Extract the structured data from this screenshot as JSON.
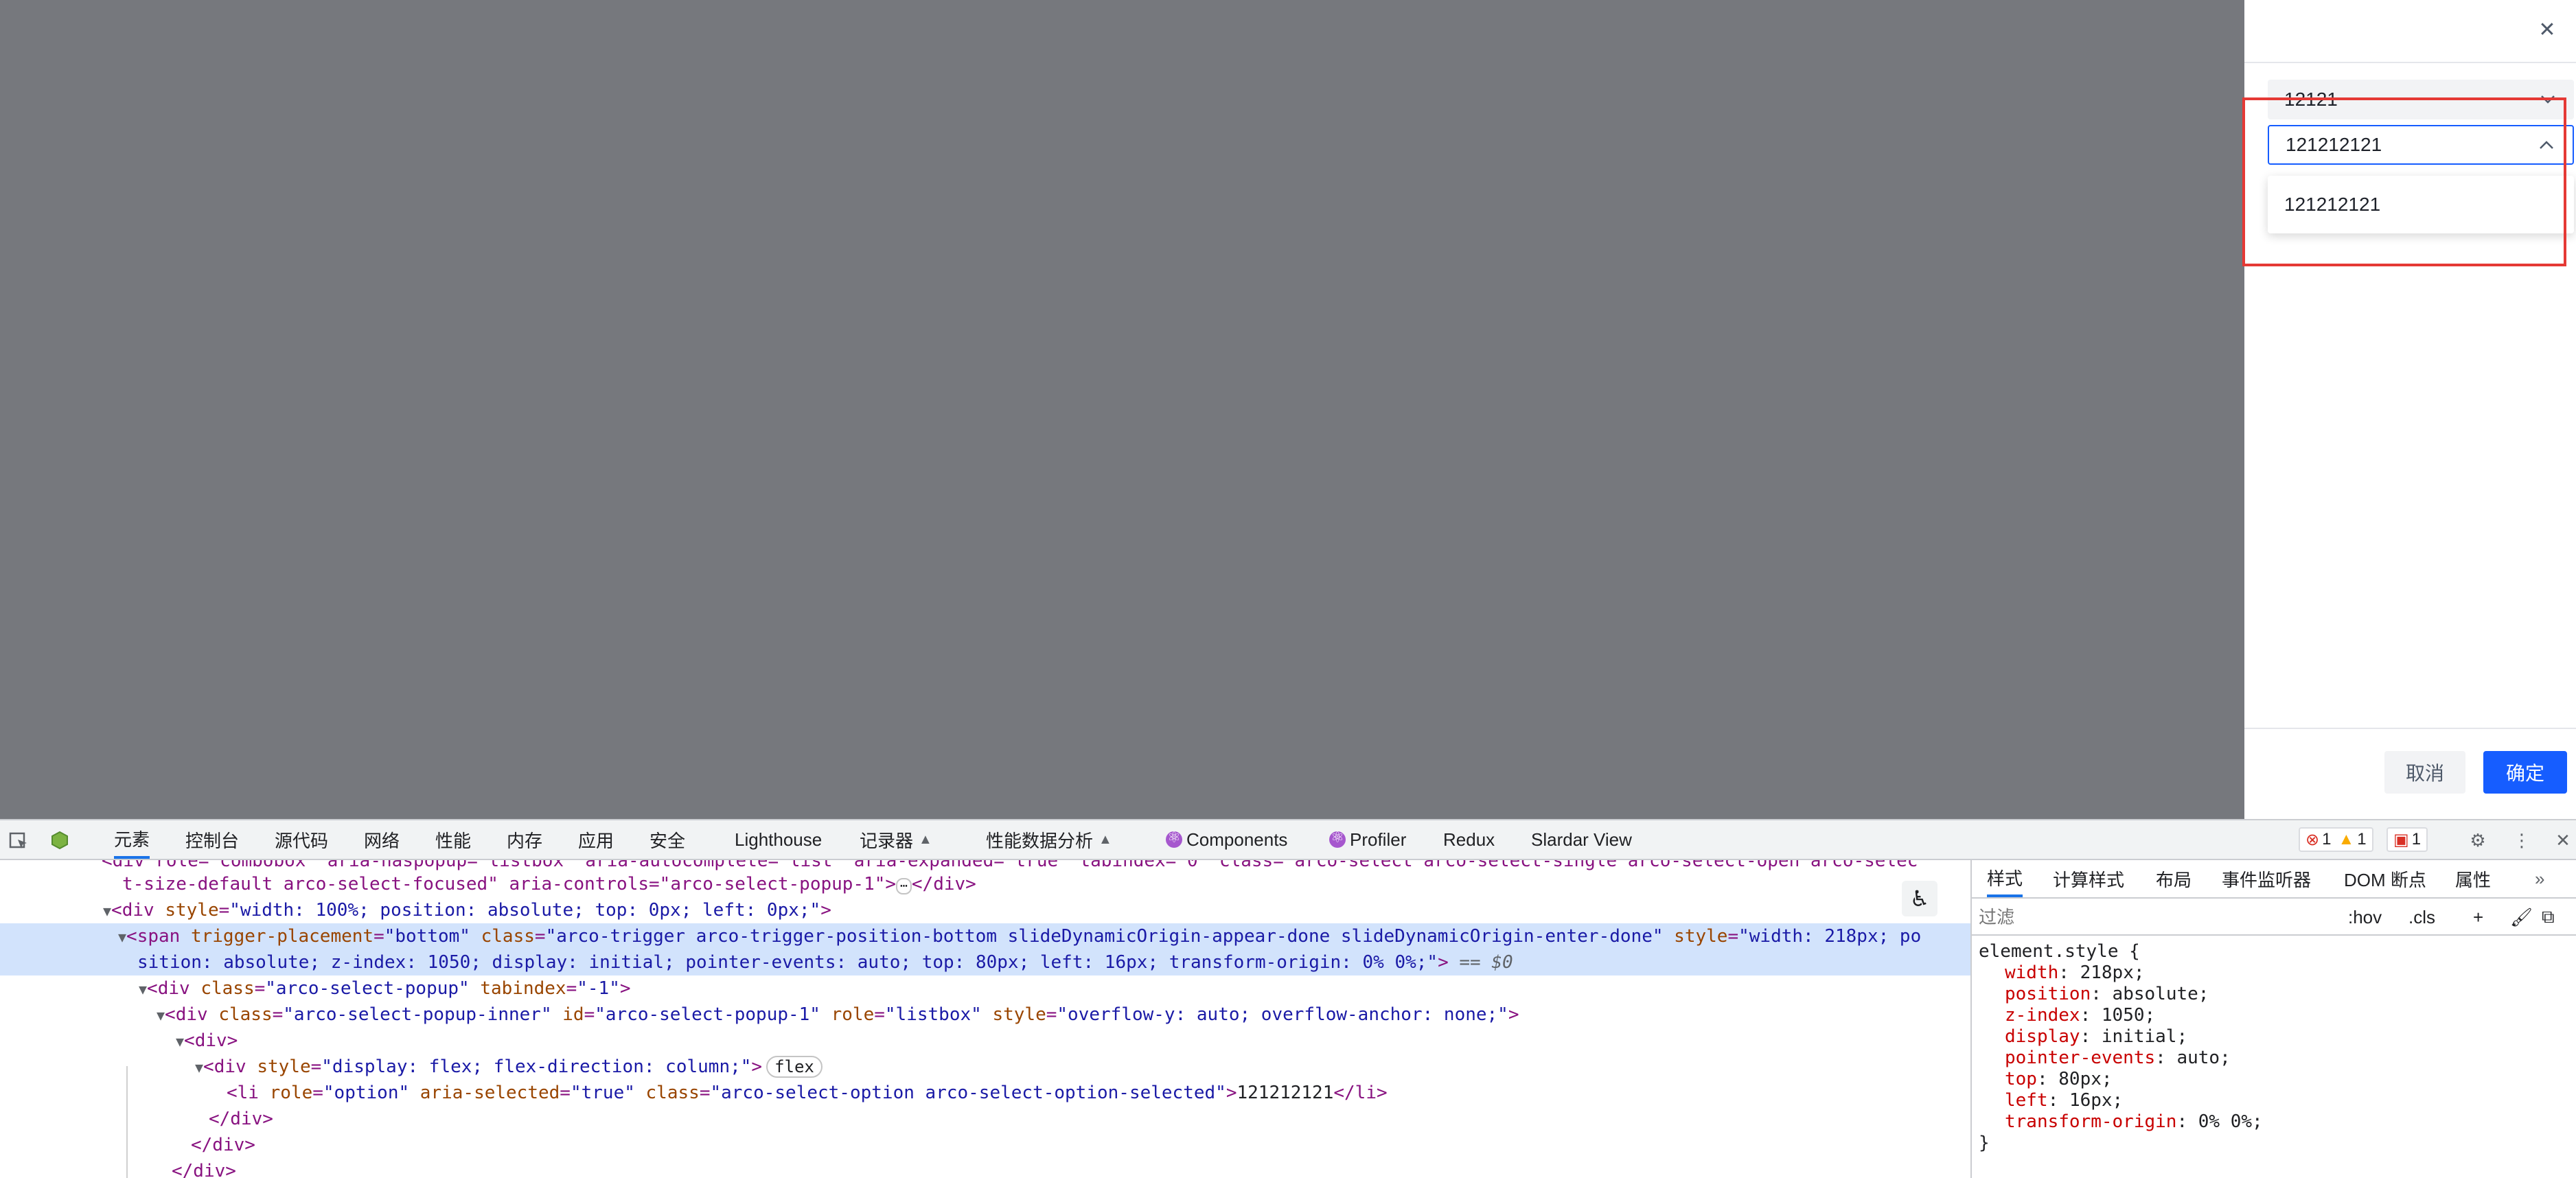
{
  "drawer": {
    "close_icon": "close-icon",
    "select1_value": "12121",
    "select2_value": "121212121",
    "popup_option": "121212121",
    "cancel_label": "取消",
    "ok_label": "确定",
    "accent_color": "#165dff",
    "highlight_color": "#e53935"
  },
  "devtools": {
    "tabs": [
      "元素",
      "控制台",
      "源代码",
      "网络",
      "性能",
      "内存",
      "应用",
      "安全",
      "Lighthouse",
      "记录器",
      "性能数据分析",
      "Components",
      "Profiler",
      "Redux",
      "Slardar View"
    ],
    "badges": {
      "errors": "1",
      "warnings": "1",
      "issues": "1"
    },
    "code": {
      "l0": "<div role=\"combobox\" aria-haspopup=\"listbox\" aria-autocomplete=\"list\" aria-expanded=\"true\" tabindex=\"0\" class=\"arco-select arco-select-single arco-select-open arco-selec",
      "l1": "t-size-default arco-select-focused\" aria-controls=\"arco-select-popup-1\">",
      "l1_ellipsis": "⋯",
      "l1_close": "</div>",
      "l2_tag": "<div ",
      "l2_attr": "style",
      "l2_val": "\"width: 100%; position: absolute; top: 0px; left: 0px;\"",
      "l3_tag": "<span ",
      "l3_a1": "trigger-placement",
      "l3_v1": "\"bottom\"",
      "l3_a2": "class",
      "l3_v2": "\"arco-trigger arco-trigger-position-bottom slideDynamicOrigin-appear-done slideDynamicOrigin-enter-done\"",
      "l3_a3": "style",
      "l3_v3a": "\"width: 218px; po",
      "l4_v3b": "sition: absolute; z-index: 1050; display: initial; pointer-events: auto; top: 80px; left: 16px; transform-origin: 0% 0%;\"",
      "l4_eq": " == $0",
      "l5_tag": "<div ",
      "l5_a1": "class",
      "l5_v1": "\"arco-select-popup\"",
      "l5_a2": "tabindex",
      "l5_v2": "\"-1\"",
      "l6_tag": "<div ",
      "l6_a1": "class",
      "l6_v1": "\"arco-select-popup-inner\"",
      "l6_a2": "id",
      "l6_v2": "\"arco-select-popup-1\"",
      "l6_a3": "role",
      "l6_v3": "\"listbox\"",
      "l6_a4": "style",
      "l6_v4": "\"overflow-y: auto; overflow-anchor: none;\"",
      "l7": "<div>",
      "l8_tag": "<div ",
      "l8_a1": "style",
      "l8_v1": "\"display: flex; flex-direction: column;\"",
      "l8_badge": "flex",
      "l9_tag": "<li ",
      "l9_a1": "role",
      "l9_v1": "\"option\"",
      "l9_a2": "aria-selected",
      "l9_v2": "\"true\"",
      "l9_a3": "class",
      "l9_v3": "\"arco-select-option arco-select-option-selected\"",
      "l9_text": "121212121",
      "l9_close": "</li>",
      "l10": "</div>",
      "l11": "</div>",
      "l12": "</div>"
    },
    "styles_tabs": [
      "样式",
      "计算样式",
      "布局",
      "事件监听器",
      "DOM 断点",
      "属性"
    ],
    "filter_placeholder": "过滤",
    "hov": ":hov",
    "cls": ".cls",
    "rule_selector": "element.style {",
    "rule_end": "}",
    "declarations": [
      {
        "prop": "width",
        "value": "218px;"
      },
      {
        "prop": "position",
        "value": "absolute;"
      },
      {
        "prop": "z-index",
        "value": "1050;"
      },
      {
        "prop": "display",
        "value": "initial;"
      },
      {
        "prop": "pointer-events",
        "value": "auto;"
      },
      {
        "prop": "top",
        "value": "80px;"
      },
      {
        "prop": "left",
        "value": "16px;"
      },
      {
        "prop": "transform-origin",
        "value": "0% 0%;"
      }
    ]
  }
}
